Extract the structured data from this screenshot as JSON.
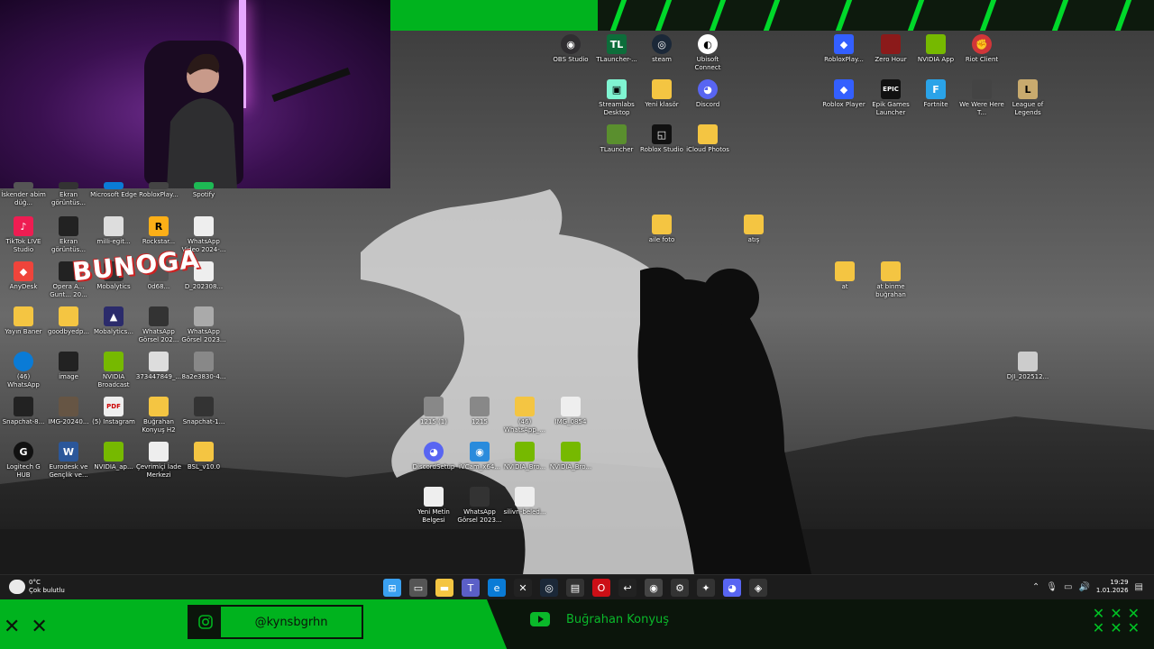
{
  "overlay": {
    "instagram_handle": "@kynsbgrhn",
    "youtube_name": "Buğrahan Konyuş",
    "logo_text": "BUNOGA"
  },
  "desktop_icons": [
    {
      "label": "İskender abim düğ...",
      "color": "#555"
    },
    {
      "label": "Ekran görüntüs...",
      "color": "#333"
    },
    {
      "label": "Microsoft Edge",
      "color": "#0a7bd6"
    },
    {
      "label": "RobloxPlay...",
      "color": "#444"
    },
    {
      "label": "Spotify",
      "color": "#1db954"
    },
    {
      "label": "TikTok LIVE Studio",
      "color": "#ee1d52"
    },
    {
      "label": "Ekran görüntüs...",
      "color": "#222"
    },
    {
      "label": "milli-egit...",
      "color": "#ddd"
    },
    {
      "label": "Rockstar...",
      "color": "#fcaf17"
    },
    {
      "label": "WhatsApp Video 2024-...",
      "color": "#eee"
    },
    {
      "label": "AnyDesk",
      "color": "#ef443b"
    },
    {
      "label": "Opera A... Gunt... 20...",
      "color": "#222"
    },
    {
      "label": "Mobalytics",
      "color": "#333"
    },
    {
      "label": "0d68...",
      "color": "#555"
    },
    {
      "label": "D_202308...",
      "color": "#eee"
    },
    {
      "label": "Yayın Baner",
      "color": "#f4c542"
    },
    {
      "label": "goodbyedp...",
      "color": "#f4c542"
    },
    {
      "label": "Mobalytics...",
      "color": "#2b2b6b"
    },
    {
      "label": "WhatsApp Görsel 202...",
      "color": "#333"
    },
    {
      "label": "WhatsApp Görsel 2023...",
      "color": "#aaa"
    },
    {
      "label": "(46) WhatsApp",
      "color": "#0a7bd6"
    },
    {
      "label": "image",
      "color": "#222"
    },
    {
      "label": "NVIDIA Broadcast",
      "color": "#76b900"
    },
    {
      "label": "373447849_...",
      "color": "#ddd"
    },
    {
      "label": "8a2e3830-4...",
      "color": "#888"
    },
    {
      "label": "Snapchat-8...",
      "color": "#222"
    },
    {
      "label": "IMG-20240...",
      "color": "#654"
    },
    {
      "label": "(5) Instagram",
      "color": "#eee"
    },
    {
      "label": "Buğrahan Konyuş H2",
      "color": "#f4c542"
    },
    {
      "label": "Snapchat-1...",
      "color": "#333"
    },
    {
      "label": "Logitech G HUB",
      "color": "#111"
    },
    {
      "label": "Eurodesk ve Gençlik ve...",
      "color": "#2b579a"
    },
    {
      "label": "NVIDIA_ap...",
      "color": "#76b900"
    },
    {
      "label": "Çevrimiçi İade Merkezi",
      "color": "#eee"
    },
    {
      "label": "BSL_v10.0",
      "color": "#f4c542"
    },
    {
      "label": "OBS Studio",
      "color": "#302e31"
    },
    {
      "label": "TLauncher-...",
      "color": "#0d6d3a"
    },
    {
      "label": "steam",
      "color": "#1b2838"
    },
    {
      "label": "Ubisoft Connect",
      "color": "#fff"
    },
    {
      "label": "Streamlabs Desktop",
      "color": "#80f5d2"
    },
    {
      "label": "Yeni klasör",
      "color": "#f4c542"
    },
    {
      "label": "Discord",
      "color": "#5865f2"
    },
    {
      "label": "TLauncher",
      "color": "#5a8f2e"
    },
    {
      "label": "Roblox Studio",
      "color": "#111"
    },
    {
      "label": "iCloud Photos",
      "color": "#f4c542"
    },
    {
      "label": "aile foto",
      "color": "#f4c542"
    },
    {
      "label": "atış",
      "color": "#f4c542"
    },
    {
      "label": "RobloxPlay...",
      "color": "#335fff"
    },
    {
      "label": "Zero Hour",
      "color": "#8b1a1a"
    },
    {
      "label": "NVIDIA App",
      "color": "#76b900"
    },
    {
      "label": "Riot Client",
      "color": "#d13639"
    },
    {
      "label": "Roblox Player",
      "color": "#335fff"
    },
    {
      "label": "Epik Games Launcher",
      "color": "#111"
    },
    {
      "label": "Fortnite",
      "color": "#2aa3e8"
    },
    {
      "label": "We Were Here T...",
      "color": "#444"
    },
    {
      "label": "League of Legends",
      "color": "#c8aa6e"
    },
    {
      "label": "at",
      "color": "#f4c542"
    },
    {
      "label": "at binme buğrahan",
      "color": "#f4c542"
    },
    {
      "label": "DJI_202512...",
      "color": "#ccc"
    },
    {
      "label": "1215 (1)",
      "color": "#888"
    },
    {
      "label": "1215",
      "color": "#888"
    },
    {
      "label": "(46) WhatsApp_...",
      "color": "#f4c542"
    },
    {
      "label": "IMG_0854",
      "color": "#eee"
    },
    {
      "label": "DiscordSetup",
      "color": "#5865f2"
    },
    {
      "label": "iVCam_x64...",
      "color": "#2a8bdc"
    },
    {
      "label": "NVIDIA_Bro...",
      "color": "#76b900"
    },
    {
      "label": "NVIDIA_Bro...",
      "color": "#76b900"
    },
    {
      "label": "Yeni Metin Belgesi",
      "color": "#eee"
    },
    {
      "label": "WhatsApp Görsel 2023...",
      "color": "#333"
    },
    {
      "label": "silivri-beled...",
      "color": "#eee"
    }
  ],
  "weather": {
    "temp": "0°C",
    "desc": "Çok bulutlu"
  },
  "taskbar_apps": [
    {
      "icon": "windows-start-icon",
      "glyph": "⊞",
      "color": "#3aa0f0"
    },
    {
      "icon": "task-view-icon",
      "glyph": "▭",
      "color": "#555"
    },
    {
      "icon": "file-explorer-icon",
      "glyph": "▬",
      "color": "#f4c542"
    },
    {
      "icon": "teams-icon",
      "glyph": "T",
      "color": "#5b5fc7"
    },
    {
      "icon": "edge-icon",
      "glyph": "e",
      "color": "#0a7bd6"
    },
    {
      "icon": "capcut-icon",
      "glyph": "✕",
      "color": "#222"
    },
    {
      "icon": "steam-icon",
      "glyph": "◎",
      "color": "#1b2838"
    },
    {
      "icon": "store-icon",
      "glyph": "▤",
      "color": "#333"
    },
    {
      "icon": "opera-icon",
      "glyph": "O",
      "color": "#cc0f16"
    },
    {
      "icon": "arrow-app-icon",
      "glyph": "↩",
      "color": "#222"
    },
    {
      "icon": "chrome-icon",
      "glyph": "◉",
      "color": "#444"
    },
    {
      "icon": "settings-icon",
      "glyph": "⚙",
      "color": "#333"
    },
    {
      "icon": "app-icon",
      "glyph": "✦",
      "color": "#333"
    },
    {
      "icon": "discord-icon",
      "glyph": "◕",
      "color": "#5865f2"
    },
    {
      "icon": "shield-icon",
      "glyph": "◈",
      "color": "#333"
    }
  ],
  "clock": {
    "time": "19:29",
    "date": "1.01.2026"
  }
}
